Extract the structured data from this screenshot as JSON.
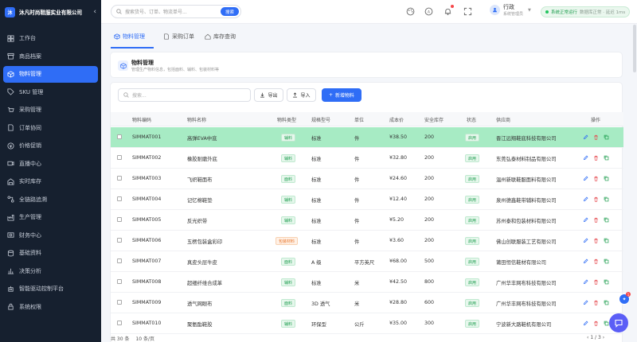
{
  "app": {
    "brand_short": "沐",
    "brand_name": "沐凡时尚鞋服实业有限公司"
  },
  "sidebar": {
    "items": [
      {
        "label": "工作台",
        "icon": "dashboard-icon"
      },
      {
        "label": "商品档案",
        "icon": "archive-icon"
      },
      {
        "label": "物料管理",
        "icon": "box-icon",
        "active": true
      },
      {
        "label": "SKU 管理",
        "icon": "tag-icon"
      },
      {
        "label": "采购管理",
        "icon": "cart-icon"
      },
      {
        "label": "订单协同",
        "icon": "document-icon"
      },
      {
        "label": "价格促销",
        "icon": "price-icon"
      },
      {
        "label": "直播中心",
        "icon": "live-icon"
      },
      {
        "label": "实时库存",
        "icon": "warehouse-icon"
      },
      {
        "label": "全链路追溯",
        "icon": "trace-icon"
      },
      {
        "label": "生产管理",
        "icon": "factory-icon"
      },
      {
        "label": "财务中心",
        "icon": "finance-icon"
      },
      {
        "label": "基础资料",
        "icon": "database-icon"
      },
      {
        "label": "决策分析",
        "icon": "chart-icon"
      },
      {
        "label": "智能驱动控制平台",
        "icon": "robot-icon"
      },
      {
        "label": "系统权限",
        "icon": "lock-icon"
      }
    ]
  },
  "topbar": {
    "search_placeholder": "搜索货号、订单、物流单号...",
    "search_button": "搜索",
    "user_name": "行政",
    "user_role": "系统管理员",
    "status_text": "系统正常运行",
    "status_sub": "数据库正常 · 延迟 1ms"
  },
  "tabs": [
    {
      "label": "物料管理",
      "icon": "box-icon",
      "active": true
    },
    {
      "label": "采购订单",
      "icon": "document-icon"
    },
    {
      "label": "库存查询",
      "icon": "home-icon"
    }
  ],
  "page_header": {
    "title": "物料管理",
    "desc": "管理生产物料信息，包括面料、辅料、包装材料等"
  },
  "toolbar": {
    "search_placeholder": "搜索...",
    "export_label": "导出",
    "import_label": "导入",
    "add_label": "新增物料"
  },
  "table": {
    "columns": [
      "物料编码",
      "物料名称",
      "物料类型",
      "规格型号",
      "单位",
      "成本价",
      "安全库存",
      "状态",
      "供应商",
      "操作"
    ],
    "rows": [
      {
        "code": "SIMMAT001",
        "name": "高弹EVA中底",
        "type": "辅料",
        "type_color": "green",
        "spec": "标准",
        "unit": "件",
        "cost": "¥38.50",
        "stock": "200",
        "status": "启用",
        "supplier": "晋江远翔鞋底科技有限公司",
        "highlight": true
      },
      {
        "code": "SIMMAT002",
        "name": "橡胶耐磨外底",
        "type": "辅料",
        "type_color": "green",
        "spec": "标准",
        "unit": "件",
        "cost": "¥32.80",
        "stock": "200",
        "status": "启用",
        "supplier": "东莞弘泰材料制品有限公司"
      },
      {
        "code": "SIMMAT003",
        "name": "飞织鞋面布",
        "type": "面料",
        "type_color": "green",
        "spec": "标准",
        "unit": "件",
        "cost": "¥24.60",
        "stock": "200",
        "status": "启用",
        "supplier": "温州新联鞋服面料有限公司"
      },
      {
        "code": "SIMMAT004",
        "name": "记忆棉鞋垫",
        "type": "辅料",
        "type_color": "green",
        "spec": "标准",
        "unit": "件",
        "cost": "¥12.40",
        "stock": "200",
        "status": "启用",
        "supplier": "泉州德鑫鞋带辅料有限公司"
      },
      {
        "code": "SIMMAT005",
        "name": "反光织带",
        "type": "辅料",
        "type_color": "green",
        "spec": "标准",
        "unit": "件",
        "cost": "¥5.20",
        "stock": "200",
        "status": "启用",
        "supplier": "苏州泰和包装材料有限公司"
      },
      {
        "code": "SIMMAT006",
        "name": "五楞包装盒彩印",
        "type": "包装材料",
        "type_color": "orange",
        "spec": "标准",
        "unit": "件",
        "cost": "¥3.60",
        "stock": "200",
        "status": "启用",
        "supplier": "佛山创联服装工艺有限公司"
      },
      {
        "code": "SIMMAT007",
        "name": "真皮头层牛皮",
        "type": "面料",
        "type_color": "green",
        "spec": "A 级",
        "unit": "平方英尺",
        "cost": "¥68.00",
        "stock": "500",
        "status": "启用",
        "supplier": "莆田恒信鞋材有限公司"
      },
      {
        "code": "SIMMAT008",
        "name": "超细纤维合成革",
        "type": "辅料",
        "type_color": "green",
        "spec": "标准",
        "unit": "米",
        "cost": "¥42.50",
        "stock": "800",
        "status": "启用",
        "supplier": "广州华丰网布科技有限公司"
      },
      {
        "code": "SIMMAT009",
        "name": "透气网眼布",
        "type": "面料",
        "type_color": "green",
        "spec": "3D 透气",
        "unit": "米",
        "cost": "¥28.80",
        "stock": "600",
        "status": "启用",
        "supplier": "广州华丰网布科技有限公司"
      },
      {
        "code": "SIMMAT010",
        "name": "聚氨酯鞋胶",
        "type": "辅料",
        "type_color": "green",
        "spec": "环保型",
        "unit": "公斤",
        "cost": "¥35.00",
        "stock": "300",
        "status": "启用",
        "supplier": "宁波新大路鞋机有限公司"
      }
    ]
  },
  "pager": {
    "total": "共 30 条",
    "page_size": "10 条/页",
    "page_info": "1 / 3"
  },
  "float": {
    "badge": "1"
  },
  "colors": {
    "primary": "#2f6df6",
    "sidebar_bg": "#16202f",
    "highlight_row": "#a7ebc4"
  }
}
